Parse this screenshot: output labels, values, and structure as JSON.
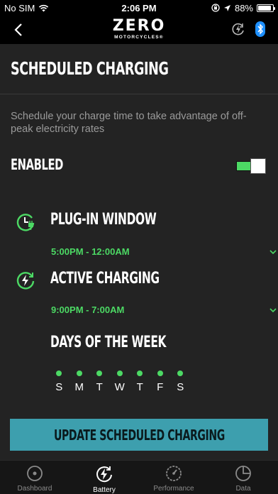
{
  "status_bar": {
    "carrier": "No SIM",
    "time": "2:06 PM",
    "battery_percent": "88%",
    "battery_level": 0.88,
    "icons": [
      "wifi-icon",
      "orientation-lock-icon",
      "location-arrow-icon",
      "battery-icon"
    ]
  },
  "nav": {
    "back_icon": "chevron-left-icon",
    "logo_main": "ZERO",
    "logo_sub": "MOTORCYCLES®",
    "right_icons": [
      "charging-status-icon",
      "bluetooth-icon"
    ]
  },
  "page": {
    "title": "SCHEDULED CHARGING",
    "description": "Schedule your charge time to take advantage of off-peak electricity rates",
    "enabled_label": "ENABLED",
    "enabled": true
  },
  "plug_in_window": {
    "title": "PLUG-IN WINDOW",
    "value": "5:00PM - 12:00AM",
    "icon": "clock-plug-icon"
  },
  "active_charging": {
    "title": "ACTIVE CHARGING",
    "value": "9:00PM - 7:00AM",
    "icon": "clock-bolt-icon"
  },
  "days_of_week": {
    "title": "DAYS OF THE WEEK",
    "days": [
      {
        "letter": "S",
        "selected": true
      },
      {
        "letter": "M",
        "selected": true
      },
      {
        "letter": "T",
        "selected": true
      },
      {
        "letter": "W",
        "selected": true
      },
      {
        "letter": "T",
        "selected": true
      },
      {
        "letter": "F",
        "selected": true
      },
      {
        "letter": "S",
        "selected": true
      }
    ]
  },
  "update_button": "UPDATE SCHEDULED CHARGING",
  "tabs": [
    {
      "label": "Dashboard",
      "icon": "dashboard-icon",
      "active": false
    },
    {
      "label": "Battery",
      "icon": "battery-bolt-icon",
      "active": true
    },
    {
      "label": "Performance",
      "icon": "speedometer-icon",
      "active": false
    },
    {
      "label": "Data",
      "icon": "pie-chart-icon",
      "active": false
    }
  ],
  "colors": {
    "accent_green": "#4cd964",
    "button_teal": "#3d9fae",
    "panel_bg": "#232323"
  }
}
